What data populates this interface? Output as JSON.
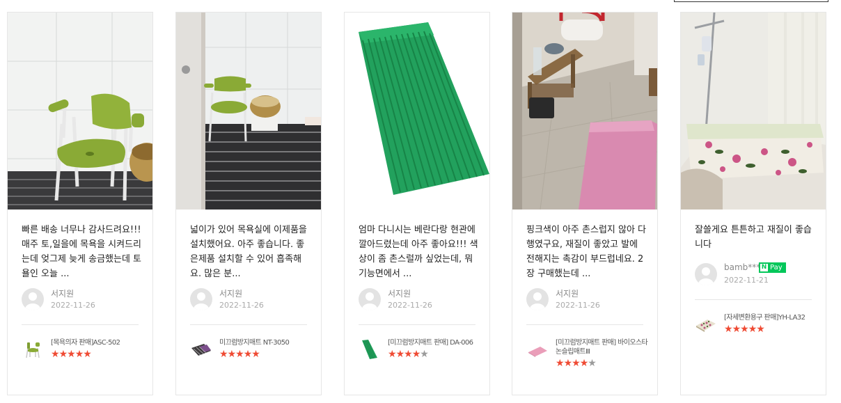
{
  "reviews": [
    {
      "text": "빠른 배송 너무나 감사드려요!!! 매주 토,일을에 목욕을 시켜드리는데 엊그제 늦게 송금했는데 토욜인 오늘 ...",
      "user": "서지원",
      "date": "2022-11-26",
      "npay": "",
      "product": "[목욕의자 판매]ASC-502",
      "rating": 5
    },
    {
      "text": "넓이가 있어 목욕실에 이제품을 설치했어요. 아주 좋습니다. 좋은제품 설치할 수 있어 흡족해요. 많은 분...",
      "user": "서지원",
      "date": "2022-11-26",
      "npay": "",
      "product": "미끄럼방지매트 NT-3050",
      "rating": 5
    },
    {
      "text": "엄마 다니시는 베란다랑 현관에 깔아드렸는데 아주 좋아요!!! 색상이 좀 촌스럴까 싶었는데, 뭐 기능면에서 ...",
      "user": "서지원",
      "date": "2022-11-26",
      "npay": "",
      "product": "[미끄럼방지매트 판매] DA-006",
      "rating": 4
    },
    {
      "text": "핑크색이 아주 촌스럽지 않아 다행였구요, 재질이 좋았고 발에 전해지는 촉감이 부드럽네요. 2장 구매했는데 ...",
      "user": "서지원",
      "date": "2022-11-26",
      "npay": "",
      "product": "[미끄럼방지매트 판매] 바이오스타 논슬립매트Ⅲ",
      "rating": 4
    },
    {
      "text": "잘쓸게요 튼튼하고 재질이 좋습니다",
      "user": "bamb****",
      "date": "2022-11-21",
      "npay": "Pay",
      "product": "[자세변환용구 판매]YH-LA32",
      "rating": 5
    }
  ],
  "icons": {
    "avatar": "default-user-avatar-icon",
    "star": "star-icon",
    "npay": "naver-pay-badge"
  },
  "colors": {
    "star_on": "#ef4b34",
    "star_off": "#9b9b9b",
    "npay_green": "#03c75a"
  }
}
